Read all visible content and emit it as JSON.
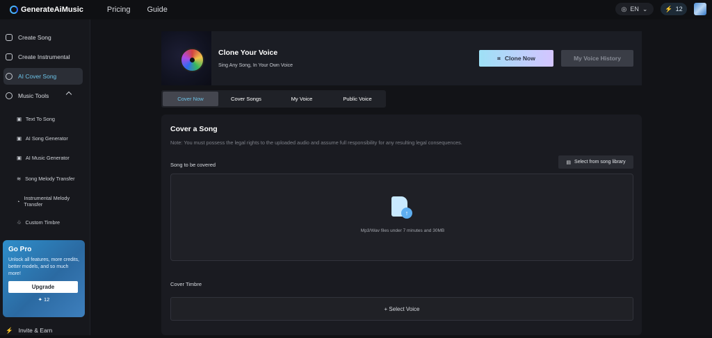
{
  "app": {
    "brand": "GenerateAiMusic",
    "nav": [
      "Pricing",
      "Guide"
    ],
    "language": "EN",
    "credits": "12"
  },
  "sidebar": {
    "items": [
      {
        "label": "Create Song"
      },
      {
        "label": "Create Instrumental"
      },
      {
        "label": "AI Cover Song",
        "active": true
      },
      {
        "label": "Music Tools"
      }
    ],
    "sub_items": [
      {
        "label": "Text To Song"
      },
      {
        "label": "AI Song Generator"
      },
      {
        "label": "AI Music Generator"
      },
      {
        "label": "Song Melody Transfer"
      },
      {
        "label": "Instrumental Melody Transfer"
      },
      {
        "label": "Custom Timbre"
      }
    ],
    "go_pro": {
      "title": "Go Pro",
      "description": "Unlock all features, more credits, better models, and so much more!",
      "upgrade_label": "Upgrade",
      "credits": "12"
    },
    "bottom_item": "Invite & Earn"
  },
  "hero": {
    "title": "Clone Your Voice",
    "subtitle": "Sing Any Song, In Your Own Voice",
    "clone_button": "Clone Now",
    "history_button": "My Voice History"
  },
  "tabs": [
    "Cover Now",
    "Cover Songs",
    "My Voice",
    "Public Voice"
  ],
  "cover": {
    "title": "Cover a Song",
    "note": "Note: You must possess the legal rights to the uploaded audio and assume full responsibility for any resulting legal consequences.",
    "song_label": "Song to be covered",
    "library_button": "Select from song library",
    "drop_text": "Mp3/Wav files under 7 minutes and 30MB",
    "timbre_label": "Cover Timbre",
    "select_voice": "+ Select Voice"
  },
  "colors": {
    "background": "#121317",
    "sidebar": "#17181d",
    "accent": "#6cc3e8",
    "primary_gradient": "#9ee0f6-#d4c5ff",
    "go_pro": "#2e8eca"
  }
}
